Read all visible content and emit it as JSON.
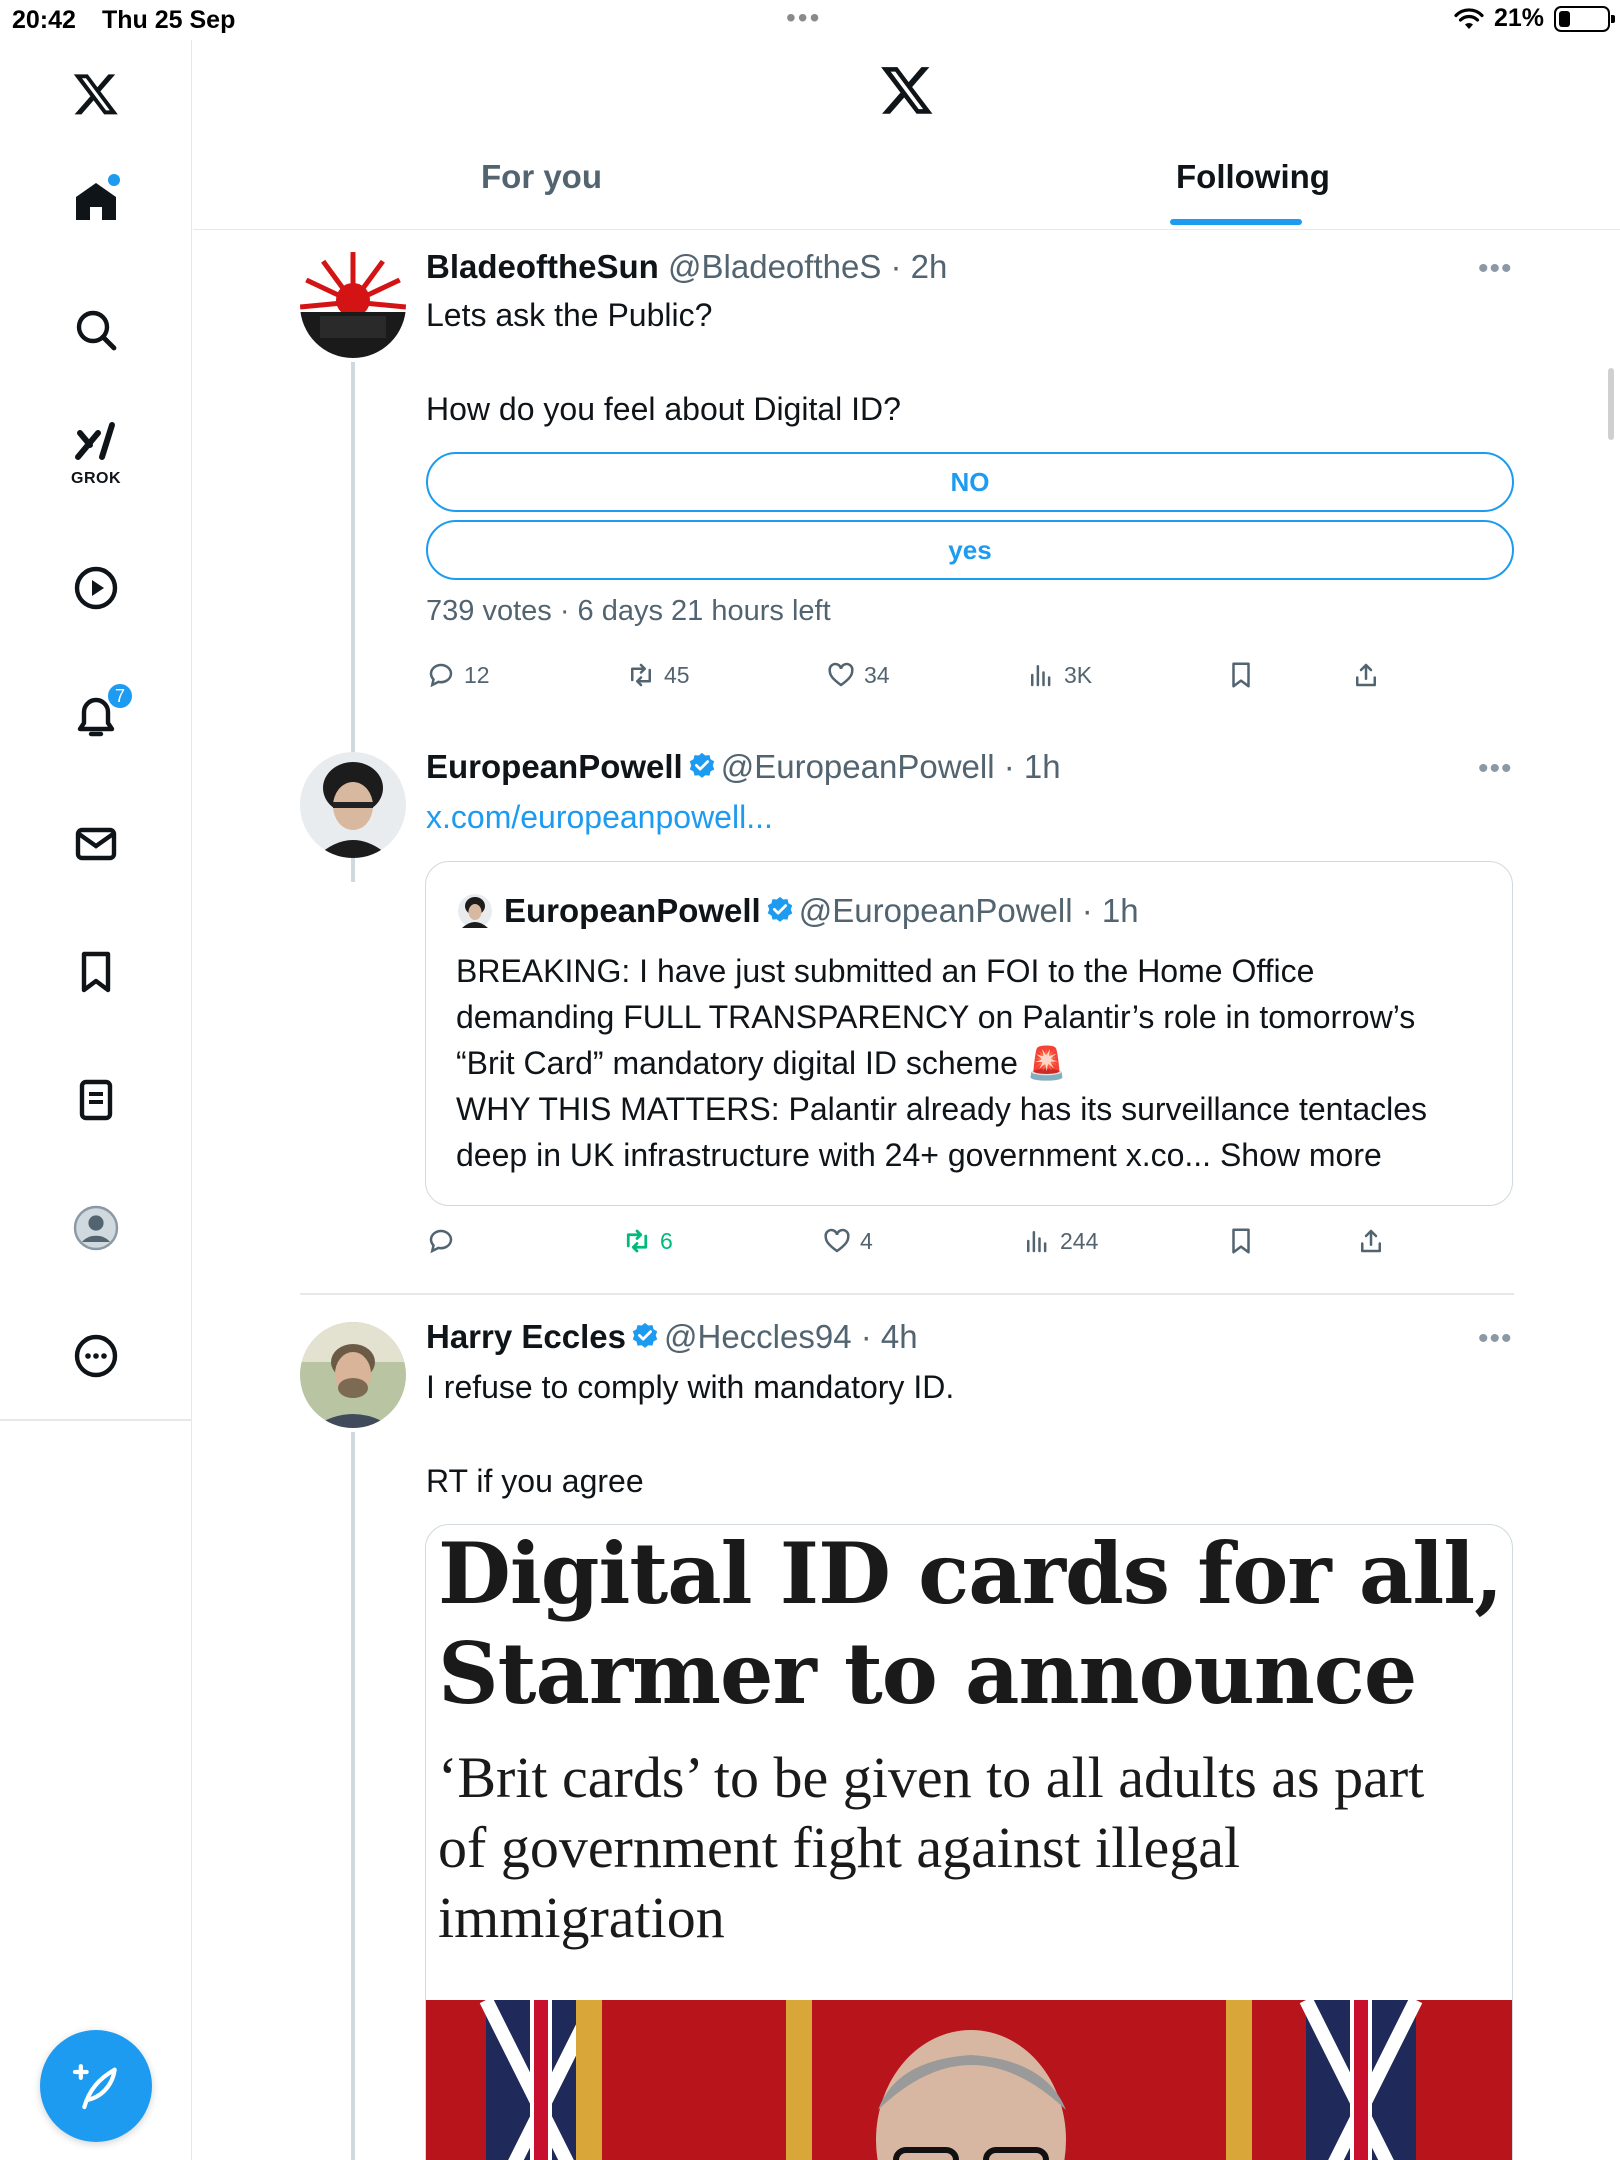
{
  "status_bar": {
    "time": "20:42",
    "date": "Thu 25 Sep",
    "battery": "21%",
    "battery_level": 0.21
  },
  "sidebar": {
    "items": [
      "home",
      "explore",
      "grok",
      "video",
      "notifications",
      "messages",
      "bookmarks",
      "lists",
      "profile",
      "more"
    ],
    "grok_label": "GROK",
    "notifications_count": "7"
  },
  "header": {
    "tabs": [
      {
        "label": "For you"
      },
      {
        "label": "Following"
      }
    ]
  },
  "posts": [
    {
      "name": "BladeoftheSun",
      "meta": "@BladeoftheS · 2h",
      "text_1": "Lets ask the Public?",
      "text_2": "How do you feel about Digital ID?",
      "poll": {
        "options": [
          "NO",
          "yes"
        ],
        "meta": "739 votes · 6 days 21 hours left"
      },
      "stats": {
        "replies": "12",
        "reposts": "45",
        "likes": "34",
        "views": "3K"
      }
    },
    {
      "name": "EuropeanPowell",
      "meta": "@EuropeanPowell · 1h",
      "link": "x.com/europeanpowell...",
      "quote": {
        "name": "EuropeanPowell",
        "meta": "@EuropeanPowell · 1h",
        "lines": [
          "BREAKING: I have just submitted an FOI to the Home Office",
          "demanding FULL TRANSPARENCY on Palantir’s role in tomorrow’s",
          "“Brit Card” mandatory digital ID scheme 🚨",
          "WHY THIS MATTERS: Palantir already has its surveillance tentacles",
          "deep in UK infrastructure with 24+ government x.co... Show more"
        ]
      },
      "stats": {
        "replies": "",
        "reposts": "6",
        "likes": "4",
        "views": "244"
      }
    },
    {
      "name": "Harry Eccles",
      "meta": "@Heccles94 · 4h",
      "text_1": "I refuse to comply with mandatory ID.",
      "text_2": "RT if you agree",
      "card": {
        "headline_1": "Digital ID cards for all,",
        "headline_2": "Starmer to announce",
        "subhead_1": "‘Brit cards’ to be given to all adults as part",
        "subhead_2": "of government fight against illegal",
        "subhead_3": "immigration"
      }
    }
  ],
  "colors": {
    "accent": "#1d9bf0",
    "text": "#0f1419",
    "muted": "#536471",
    "repost_active": "#00ba7c",
    "border": "#cfd9de"
  }
}
